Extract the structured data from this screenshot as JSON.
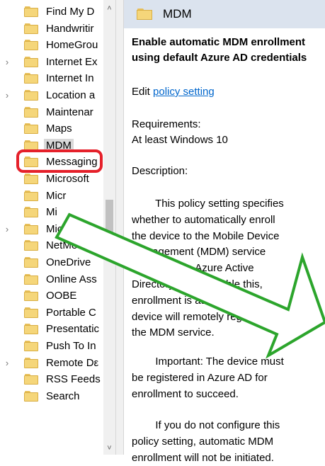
{
  "tree": {
    "items": [
      {
        "label": "Find My D",
        "expander": ""
      },
      {
        "label": "Handwritir",
        "expander": ""
      },
      {
        "label": "HomeGrou",
        "expander": ""
      },
      {
        "label": "Internet Ex",
        "expander": "›"
      },
      {
        "label": "Internet In",
        "expander": ""
      },
      {
        "label": "Location a",
        "expander": "›"
      },
      {
        "label": "Maintenar",
        "expander": ""
      },
      {
        "label": "Maps",
        "expander": ""
      },
      {
        "label": "MDM",
        "expander": ""
      },
      {
        "label": "Messaging",
        "expander": ""
      },
      {
        "label": "Microsoft",
        "expander": ""
      },
      {
        "label": "Micr",
        "expander": ""
      },
      {
        "label": "Mi",
        "expander": ""
      },
      {
        "label": "Microsof",
        "expander": "›"
      },
      {
        "label": "NetMeetir",
        "expander": ""
      },
      {
        "label": "OneDrive",
        "expander": ""
      },
      {
        "label": "Online Ass",
        "expander": ""
      },
      {
        "label": "OOBE",
        "expander": ""
      },
      {
        "label": "Portable C",
        "expander": ""
      },
      {
        "label": "Presentatic",
        "expander": ""
      },
      {
        "label": "Push To In",
        "expander": ""
      },
      {
        "label": "Remote Dε",
        "expander": "›"
      },
      {
        "label": "RSS Feeds",
        "expander": ""
      },
      {
        "label": "Search",
        "expander": ""
      }
    ],
    "selected": "MDM",
    "scroll_up": "˄",
    "scroll_down": "˅"
  },
  "header": {
    "title": "MDM"
  },
  "details": {
    "heading_line1": "Enable automatic MDM enrollment",
    "heading_line2": "using default Azure AD credentials",
    "edit_prefix": "Edit ",
    "edit_link": "policy setting",
    "requirements_label": "Requirements:",
    "requirements_value": "At least Windows 10",
    "description_label": "Description:",
    "desc_lines": [
      "        This policy setting specifies",
      "whether to automatically enroll",
      "the device to the Mobile Device",
      "Management (MDM) service",
      "configured in Azure Active",
      "Directory. If you enable this,",
      "enrollment is automatic. The",
      "device will remotely register with",
      "the MDM service."
    ],
    "important_lines": [
      "        Important: The device must",
      "be registered in Azure AD for",
      "enrollment to succeed."
    ],
    "notconfig_lines": [
      "        If you do not configure this",
      "policy setting, automatic MDM",
      "enrollment will not be initiated."
    ]
  },
  "colors": {
    "highlight": "#e5202a",
    "arrow_stroke": "#2ca52c",
    "link": "#0066cc",
    "header_bg": "#dbe3ee"
  }
}
